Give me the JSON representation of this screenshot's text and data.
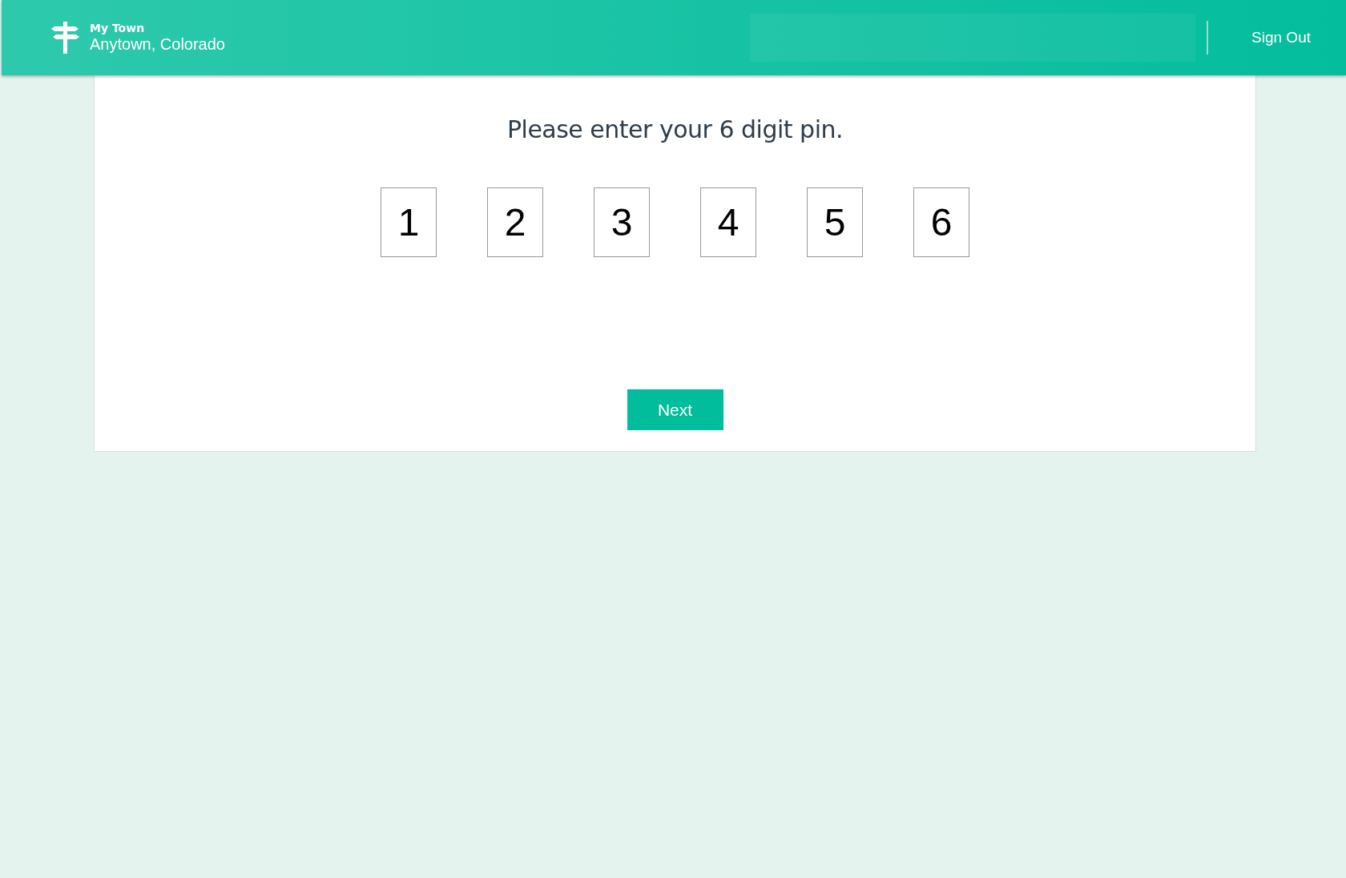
{
  "header": {
    "app_name": "My Town",
    "location": "Anytown, Colorado",
    "sign_out": "Sign Out"
  },
  "pin_form": {
    "prompt": "Please enter your 6 digit pin.",
    "digits": [
      "1",
      "2",
      "3",
      "4",
      "5",
      "6"
    ],
    "next_button": "Next"
  }
}
